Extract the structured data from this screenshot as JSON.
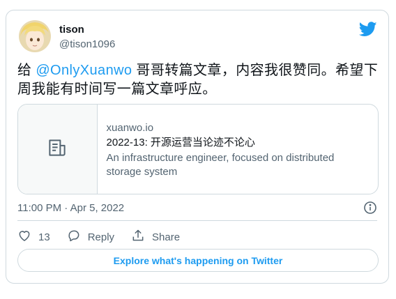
{
  "tweet": {
    "author_name": "tison",
    "author_handle": "@tison1096",
    "text_before": "给 ",
    "mention": "@OnlyXuanwo",
    "text_after": " 哥哥转篇文章，内容我很赞同。希望下周我能有时间写一篇文章呼应。",
    "timestamp": "11:00 PM · Apr 5, 2022"
  },
  "link_card": {
    "domain": "xuanwo.io",
    "title": "2022-13: 开源运营当论迹不论心",
    "description": "An infrastructure engineer, focused on distributed storage system",
    "icon": "document-icon"
  },
  "actions": {
    "like_count": "13",
    "reply_label": "Reply",
    "share_label": "Share"
  },
  "explore_label": "Explore what's happening on Twitter",
  "colors": {
    "accent": "#1d9bf0",
    "text": "#0f1419",
    "secondary": "#536471",
    "border": "#cfd9de"
  }
}
